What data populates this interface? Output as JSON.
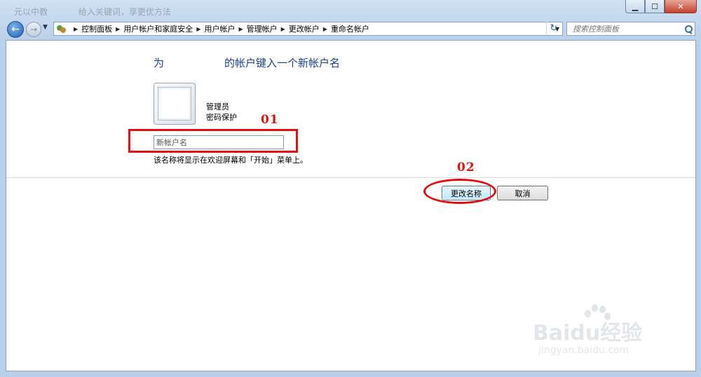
{
  "window": {
    "caption_faded": [
      "元以中教",
      "给入关键词，享更优方法"
    ],
    "buttons": {
      "minimize": "▁",
      "maximize": "☐",
      "close": "✕"
    }
  },
  "navigation": {
    "back_icon": "back-arrow-icon",
    "forward_icon": "forward-arrow-icon",
    "breadcrumb": [
      "控制面板",
      "用户帐户和家庭安全",
      "用户帐户",
      "管理帐户",
      "更改帐户",
      "重命名帐户"
    ],
    "search_placeholder": "搜索控制面板"
  },
  "main": {
    "heading_prefix": "为",
    "heading_suffix": "的帐户键入一个新帐户名",
    "account_role": "管理员",
    "account_password": "密码保护",
    "new_name_placeholder": "新帐户名",
    "hint": "该名称将显示在欢迎屏幕和「开始」菜单上。",
    "change_name_button": "更改名称",
    "cancel_button": "取消"
  },
  "annotations": {
    "label_01": "01",
    "label_02": "02",
    "color": "#e01010"
  },
  "watermark": {
    "brand": "Baidu经验",
    "site": "jingyan.baidu.com"
  }
}
